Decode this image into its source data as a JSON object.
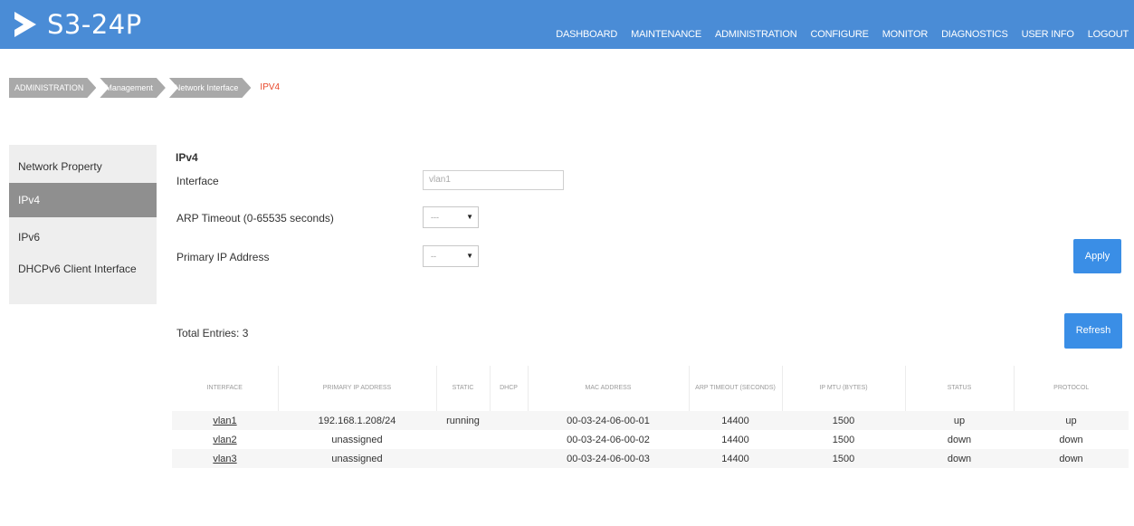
{
  "header": {
    "logo_text": "S3-24P",
    "nav": [
      "DASHBOARD",
      "MAINTENANCE",
      "ADMINISTRATION",
      "CONFIGURE",
      "MONITOR",
      "DIAGNOSTICS",
      "USER INFO",
      "LOGOUT"
    ],
    "bg_color": "#4a8cd6"
  },
  "breadcrumb": [
    "ADMINISTRATION",
    "Management",
    "Network Interface",
    "IPV4"
  ],
  "sidebar": {
    "items": [
      {
        "label": "Network Property",
        "active": false
      },
      {
        "label": "IPv4",
        "active": true
      },
      {
        "label": "IPv6",
        "active": false
      },
      {
        "label": "DHCPv6 Client Interface",
        "active": false
      }
    ]
  },
  "form": {
    "title": "IPv4",
    "interface_label": "Interface",
    "interface_value": "vlan1",
    "arp_label": "ARP Timeout (0-65535 seconds)",
    "arp_value": "---",
    "primary_ip_label": "Primary IP Address",
    "primary_ip_value": "--",
    "apply_label": "Apply"
  },
  "table": {
    "total_label": "Total Entries: 3",
    "refresh_label": "Refresh",
    "headers": [
      "INTERFACE",
      "PRIMARY IP ADDRESS",
      "STATIC",
      "DHCP",
      "MAC ADDRESS",
      "ARP TIMEOUT (SECONDS)",
      "IP MTU (BYTES)",
      "STATUS",
      "PROTOCOL"
    ],
    "rows": [
      [
        "vlan1",
        "192.168.1.208/24",
        "running",
        "",
        "00-03-24-06-00-01",
        "14400",
        "1500",
        "up",
        "up"
      ],
      [
        "vlan2",
        "unassigned",
        "",
        "",
        "00-03-24-06-00-02",
        "14400",
        "1500",
        "down",
        "down"
      ],
      [
        "vlan3",
        "unassigned",
        "",
        "",
        "00-03-24-06-00-03",
        "14400",
        "1500",
        "down",
        "down"
      ]
    ]
  },
  "colors": {
    "accent": "#3a8ee6",
    "breadcrumb_current": "#e8472a",
    "sidebar_active": "#8f8f8f"
  }
}
